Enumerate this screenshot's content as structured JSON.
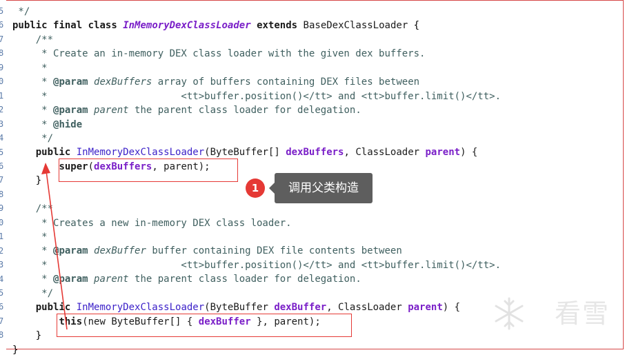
{
  "gutter_numbers": [
    "5",
    "6",
    "7",
    "8",
    "9",
    "0",
    "1",
    "2",
    "3",
    "4",
    "5",
    "6",
    "7",
    "8",
    "9",
    "0",
    "1",
    "2",
    "3",
    "4",
    "5",
    "6",
    "7",
    "8"
  ],
  "code": {
    "l1_comment_end": " */",
    "l2_public": "public",
    "l2_final": "final",
    "l2_class": "class",
    "l2_classname": "InMemoryDexClassLoader",
    "l2_extends": "extends",
    "l2_super": "BaseDexClassLoader",
    "l2_brace": " {",
    "l3": "    /**",
    "l4": "     * Create an in-memory DEX class loader with the given dex buffers.",
    "l5": "     *",
    "l6_prefix": "     * ",
    "l6_tag": "@param",
    "l6_name": "dexBuffers",
    "l6_rest": " array of buffers containing DEX files between",
    "l7": "     *                       <tt>buffer.position()</tt> and <tt>buffer.limit()</tt>.",
    "l8_prefix": "     * ",
    "l8_tag": "@param",
    "l8_name": "parent",
    "l8_rest": " the parent class loader for delegation.",
    "l9_prefix": "     * ",
    "l9_tag": "@hide",
    "l10": "     */",
    "l11_public": "public",
    "l11_name": "InMemoryDexClassLoader",
    "l11_open": "(ByteBuffer[] ",
    "l11_p1": "dexBuffers",
    "l11_mid": ", ClassLoader ",
    "l11_p2": "parent",
    "l11_close": ") {",
    "l12_super": "super",
    "l12_open": "(",
    "l12_p1": "dexBuffers",
    "l12_rest": ", parent);",
    "l13": "    }",
    "l14": "",
    "l15": "    /**",
    "l16": "     * Creates a new in-memory DEX class loader.",
    "l17": "     *",
    "l18_prefix": "     * ",
    "l18_tag": "@param",
    "l18_name": "dexBuffer",
    "l18_rest": " buffer containing DEX file contents between",
    "l19": "     *                       <tt>buffer.position()</tt> and <tt>buffer.limit()</tt>.",
    "l20_prefix": "     * ",
    "l20_tag": "@param",
    "l20_name": "parent",
    "l20_rest": " the parent class loader for delegation.",
    "l21": "     */",
    "l22_public": "public",
    "l22_name": "InMemoryDexClassLoader",
    "l22_open": "(ByteBuffer ",
    "l22_p1": "dexBuffer",
    "l22_mid": ", ClassLoader ",
    "l22_p2": "parent",
    "l22_close": ") {",
    "l23_this": "this",
    "l23_open": "(new ",
    "l23_type": "ByteBuffer",
    "l23_arr": "[] { ",
    "l23_p1": "dexBuffer",
    "l23_rest": " }, parent);",
    "l24": "    }",
    "l25": "}"
  },
  "annotation": {
    "badge_number": "1",
    "tooltip_text": "调用父类构造"
  },
  "watermark": {
    "text": "看雪"
  },
  "colors": {
    "highlight_red": "#e53935",
    "tooltip_bg": "#5e5e5e",
    "param_purple": "#7a1fc8",
    "method_blue": "#3a1fc8",
    "comment": "#3f5f5f"
  }
}
